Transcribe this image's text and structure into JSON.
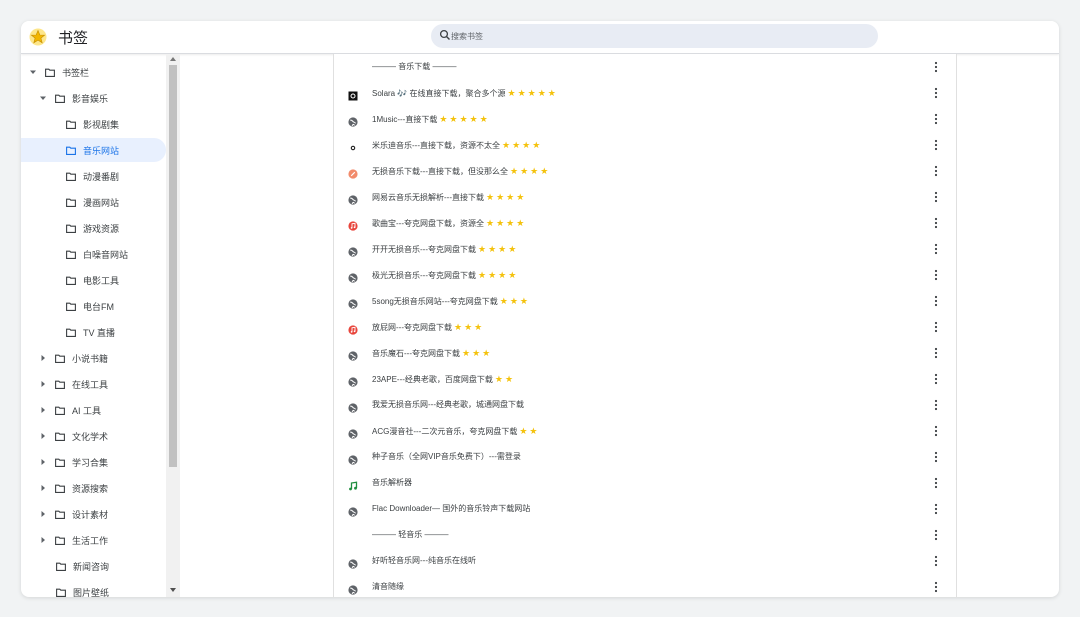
{
  "header": {
    "title": "书签",
    "search_placeholder": "搜索书签"
  },
  "sidebar": {
    "items": [
      {
        "label": "书签栏",
        "expanded": true
      },
      {
        "label": "影音娱乐",
        "expanded": true
      },
      {
        "label": "影视剧集"
      },
      {
        "label": "音乐网站",
        "selected": true
      },
      {
        "label": "动漫番剧"
      },
      {
        "label": "漫画网站"
      },
      {
        "label": "游戏资源"
      },
      {
        "label": "白噪音网站"
      },
      {
        "label": "电影工具"
      },
      {
        "label": "电台FM"
      },
      {
        "label": "TV 直播"
      },
      {
        "label": "小说书籍",
        "expanded": false
      },
      {
        "label": "在线工具",
        "expanded": false
      },
      {
        "label": "AI 工具",
        "expanded": false
      },
      {
        "label": "文化学术",
        "expanded": false
      },
      {
        "label": "学习合集",
        "expanded": false
      },
      {
        "label": "资源搜索",
        "expanded": false
      },
      {
        "label": "设计素材",
        "expanded": false
      },
      {
        "label": "生活工作",
        "expanded": false
      },
      {
        "label": "新闻咨询"
      },
      {
        "label": "图片壁纸"
      }
    ]
  },
  "bookmarks": [
    {
      "label": "——— 音乐下载 ———",
      "icon": "none",
      "stars": ""
    },
    {
      "label": "Solara 🎶 在线直接下载，聚合多个源",
      "icon": "black-square-icon",
      "stars": "★★★★★"
    },
    {
      "label": "1Music---直接下载",
      "icon": "globe-icon",
      "stars": "★★★★★"
    },
    {
      "label": "米乐迪音乐---直接下载，资源不太全",
      "icon": "dot-icon",
      "stars": "★★★★"
    },
    {
      "label": "无损音乐下载---直接下载，但没那么全",
      "icon": "orange-circle-icon",
      "stars": "★★★★"
    },
    {
      "label": "网易云音乐无损解析---直接下载",
      "icon": "globe-icon",
      "stars": "★★★★"
    },
    {
      "label": "歌曲宝---夸克网盘下载，资源全",
      "icon": "red-music-icon",
      "stars": "★★★★"
    },
    {
      "label": "开开无损音乐---夸克网盘下载",
      "icon": "globe-icon",
      "stars": "★★★★"
    },
    {
      "label": "极光无损音乐---夸克网盘下载",
      "icon": "globe-icon",
      "stars": "★★★★"
    },
    {
      "label": "5song无损音乐网站---夸克网盘下载",
      "icon": "globe-icon",
      "stars": "★★★"
    },
    {
      "label": "放屁网---夸克网盘下载",
      "icon": "red-music-icon",
      "stars": "★★★"
    },
    {
      "label": "音乐魔石---夸克网盘下载",
      "icon": "globe-icon",
      "stars": "★★★"
    },
    {
      "label": "23APE---经典老歌，百度网盘下载",
      "icon": "globe-icon",
      "stars": "★★"
    },
    {
      "label": "我爱无损音乐网---经典老歌，城通网盘下载",
      "icon": "globe-icon",
      "stars": ""
    },
    {
      "label": "ACG漫音社---二次元音乐，夸克网盘下载",
      "icon": "globe-icon",
      "stars": "★★"
    },
    {
      "label": "种子音乐（全网VIP音乐免费下）---需登录",
      "icon": "globe-icon",
      "stars": ""
    },
    {
      "label": "音乐解析器",
      "icon": "green-note-icon",
      "stars": ""
    },
    {
      "label": "Flac Downloader— 国外的音乐铃声下载网站",
      "icon": "globe-icon",
      "stars": ""
    },
    {
      "label": "——— 轻音乐 ———",
      "icon": "none",
      "stars": ""
    },
    {
      "label": "好听轻音乐网---纯音乐在线听",
      "icon": "globe-icon",
      "stars": ""
    },
    {
      "label": "清音随缘",
      "icon": "globe-icon",
      "stars": ""
    }
  ],
  "colors": {
    "accent": "#1a73e8",
    "star": "#f4c20d",
    "selected_bg": "#e8f0fe"
  }
}
